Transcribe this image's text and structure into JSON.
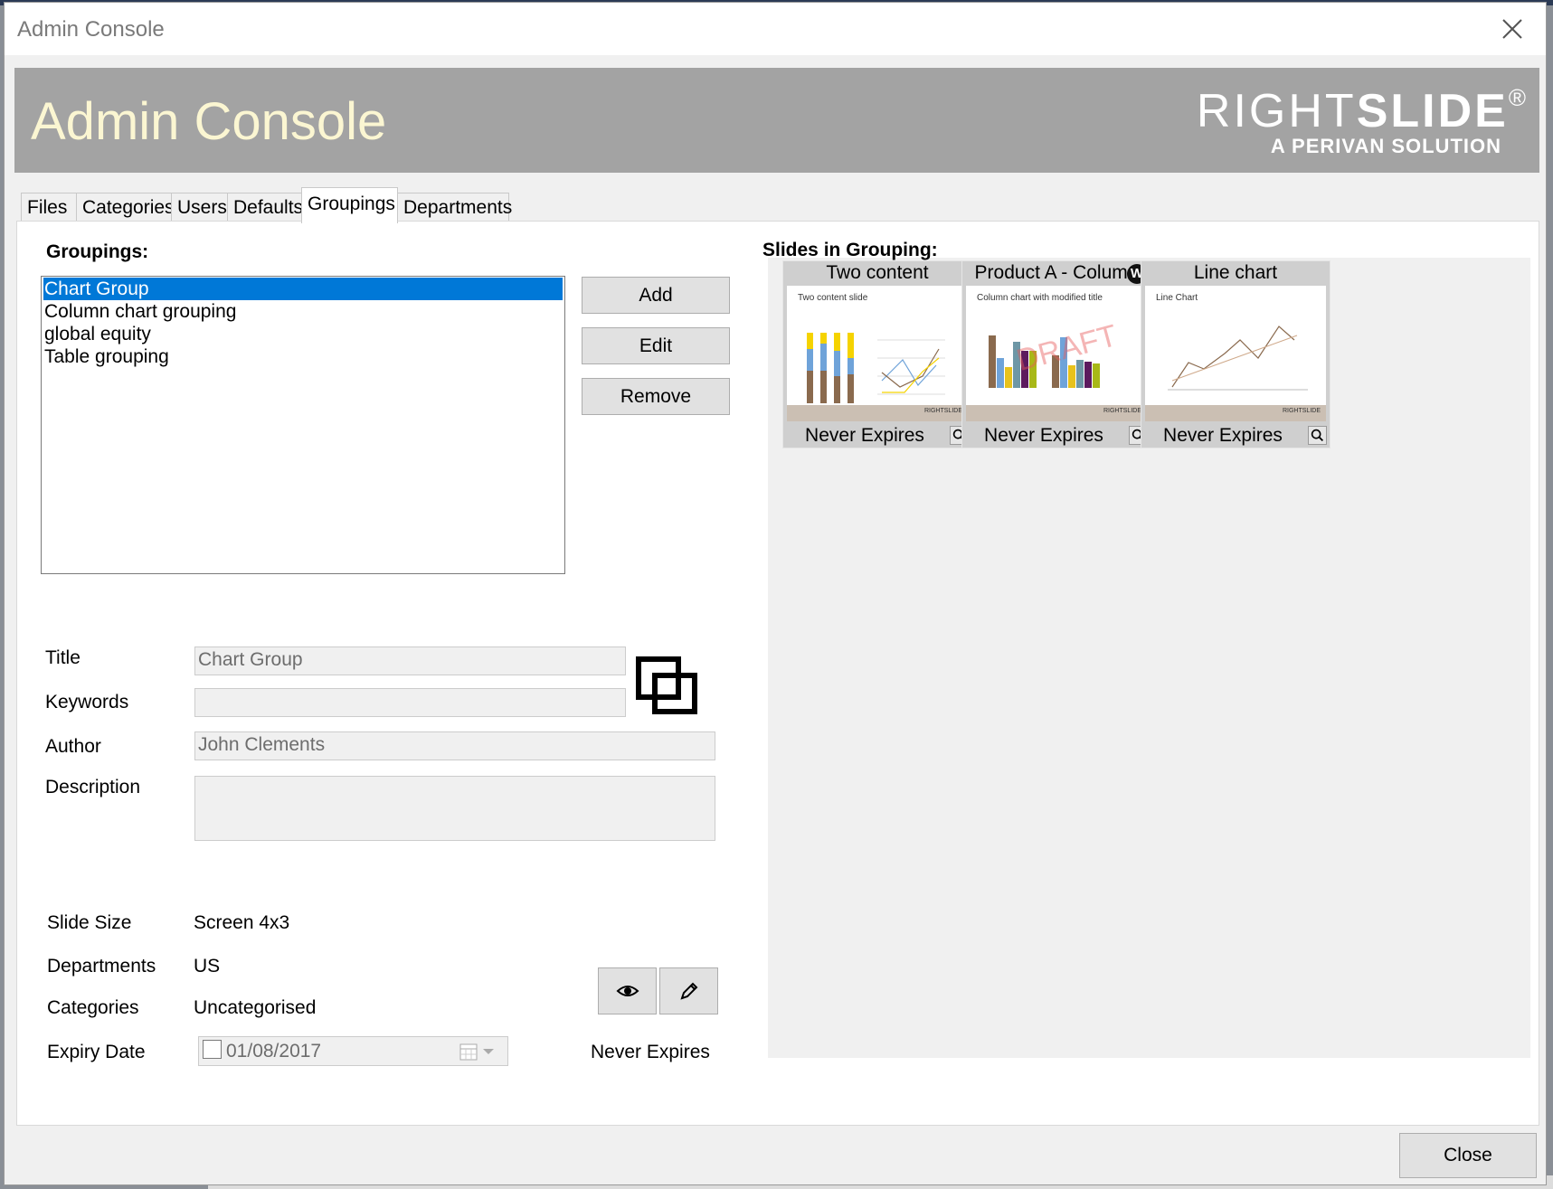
{
  "window": {
    "title": "Admin Console"
  },
  "banner": {
    "title": "Admin Console",
    "logo_main_light": "RIGHT",
    "logo_main_bold": "SLIDE",
    "logo_reg": "®",
    "logo_sub": "A PERIVAN SOLUTION"
  },
  "tabs": [
    {
      "label": "Files"
    },
    {
      "label": "Categories"
    },
    {
      "label": "Users"
    },
    {
      "label": "Defaults"
    },
    {
      "label": "Groupings",
      "active": true
    },
    {
      "label": "Departments"
    }
  ],
  "groupings": {
    "heading": "Groupings:",
    "items": [
      {
        "label": "Chart Group",
        "selected": true
      },
      {
        "label": "Column chart grouping"
      },
      {
        "label": "global equity"
      },
      {
        "label": "Table grouping"
      }
    ],
    "add_label": "Add",
    "edit_label": "Edit",
    "remove_label": "Remove"
  },
  "details": {
    "title_label": "Title",
    "title_value": "Chart Group",
    "keywords_label": "Keywords",
    "keywords_value": "",
    "author_label": "Author",
    "author_value": "John Clements",
    "description_label": "Description",
    "description_value": "",
    "slide_size_label": "Slide Size",
    "slide_size_value": "Screen 4x3",
    "departments_label": "Departments",
    "departments_value": "US",
    "categories_label": "Categories",
    "categories_value": "Uncategorised",
    "expiry_label": "Expiry Date",
    "expiry_value": "01/08/2017",
    "expiry_status": "Never Expires"
  },
  "slides": {
    "heading": "Slides in Grouping:",
    "items": [
      {
        "title": "Two content",
        "thumb_title": "Two content slide",
        "expiry": "Never Expires",
        "footer": "RIGHTSLIDE"
      },
      {
        "title": "Product A - Column",
        "thumb_title": "Column chart with modified title",
        "expiry": "Never Expires",
        "footer": "RIGHTSLIDE",
        "badge": "W",
        "watermark": "DRAFT"
      },
      {
        "title": "Line chart",
        "thumb_title": "Line Chart",
        "expiry": "Never Expires",
        "footer": "RIGHTSLIDE"
      }
    ]
  },
  "footer": {
    "close_label": "Close"
  },
  "icons": {
    "window_close": "close-icon",
    "copy": "copy-icon",
    "preview": "eye-icon",
    "edit": "pencil-icon",
    "calendar": "calendar-icon",
    "dropdown": "chevron-down-icon",
    "zoom": "magnifier-icon"
  },
  "colors": {
    "selection": "#0078d7",
    "banner_bg": "#a3a3a3",
    "banner_title": "#fbf6d2"
  }
}
